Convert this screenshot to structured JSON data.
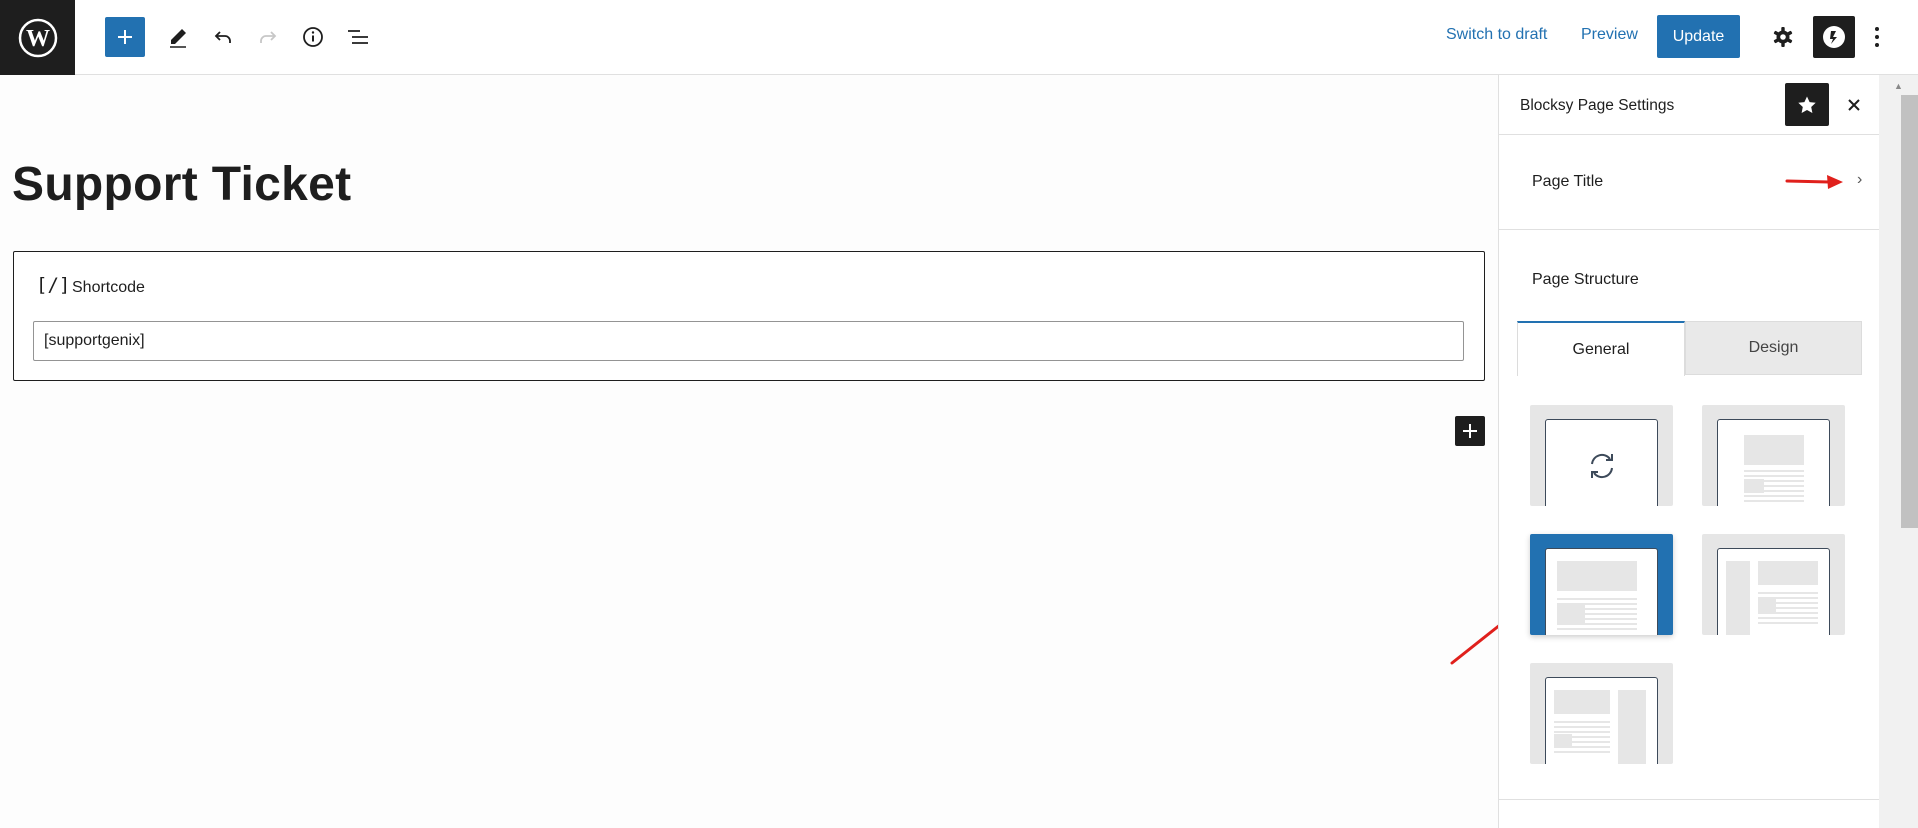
{
  "toolbar": {
    "switch_to_draft": "Switch to draft",
    "preview": "Preview",
    "update": "Update",
    "icons": [
      "wordpress-logo",
      "plus",
      "pencil",
      "undo",
      "redo",
      "info",
      "list-view",
      "gear",
      "blocksy",
      "more-vertical"
    ]
  },
  "editor": {
    "page_title": "Support Ticket",
    "shortcode_block": {
      "icon_glyph": "[/]",
      "label": "Shortcode",
      "value": "[supportgenix]"
    }
  },
  "sidebar": {
    "title": "Blocksy Page Settings",
    "page_title_row": "Page Title",
    "page_structure_label": "Page Structure",
    "tabs": [
      {
        "label": "General",
        "active": true
      },
      {
        "label": "Design",
        "active": false
      }
    ],
    "layouts": [
      {
        "name": "inherit",
        "selected": false
      },
      {
        "name": "no-sidebar",
        "selected": false
      },
      {
        "name": "normal-width",
        "selected": true
      },
      {
        "name": "left-sidebar",
        "selected": false
      },
      {
        "name": "right-sidebar",
        "selected": false
      }
    ]
  },
  "colors": {
    "accent": "#2271b1",
    "dark": "#1e1e1e",
    "annotation_arrow": "#e0201c"
  }
}
